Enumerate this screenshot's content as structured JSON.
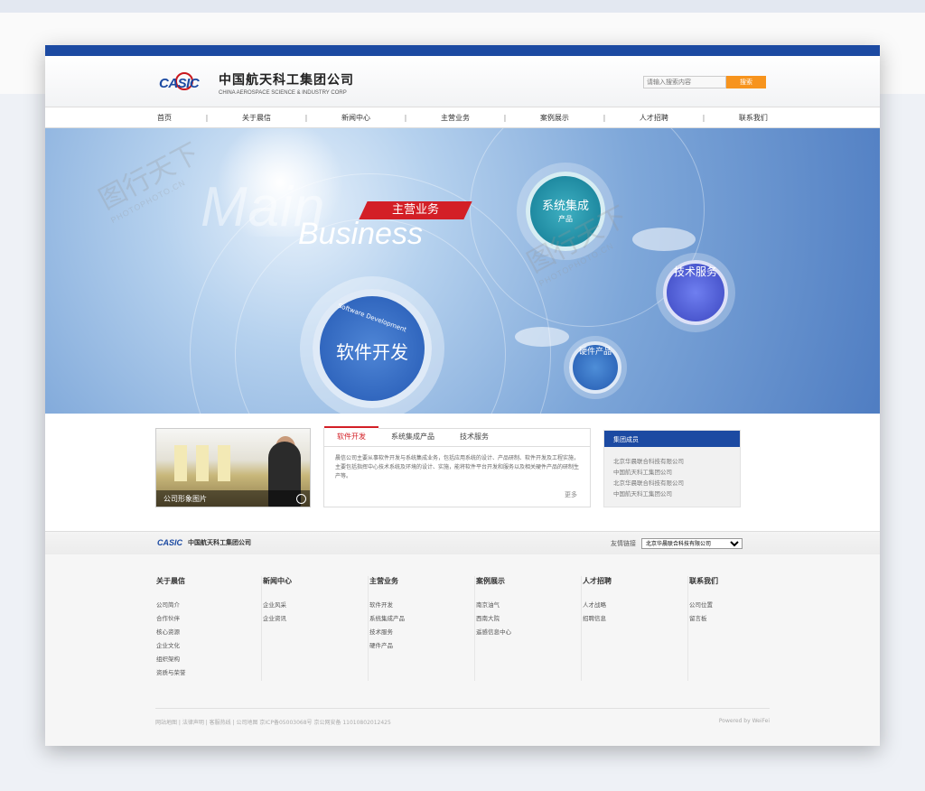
{
  "header": {
    "logo_mark": "CASIC",
    "company_cn": "中国航天科工集团公司",
    "company_en": "CHINA AEROSPACE SCIENCE & INDUSTRY CORP",
    "search_placeholder": "请输入搜索内容",
    "search_button": "搜索"
  },
  "nav": [
    "首页",
    "关于晨信",
    "新闻中心",
    "主营业务",
    "案例展示",
    "人才招聘",
    "联系我们"
  ],
  "banner": {
    "main": "Main",
    "business": "Business",
    "ribbon": "主营业务",
    "big_circle_sub": "Software Development",
    "big_circle_title": "软件开发",
    "system_title": "系统集成",
    "system_sub": "产品",
    "tech": "技术服务",
    "hardware": "硬件产品"
  },
  "content": {
    "photo_caption": "公司形象图片",
    "tabs": [
      "软件开发",
      "系统集成产品",
      "技术服务"
    ],
    "active_tab": 0,
    "tab_text": "晨信公司主要从事软件开发与系统集成业务，包括应用系统的设计、产品研制、软件开发及工程实施，主要包括指挥中心技术系统及环境的设计、实施，能将软件平台开发和服务以及相关硬件产品的研制生产等。",
    "more": "更多",
    "group_title": "集团成员",
    "group_items": [
      "北京华晨联合科技有限公司",
      "中国航天科工集团公司",
      "北京华晨联合科技有限公司",
      "中国航天科工集团公司"
    ]
  },
  "footer": {
    "logo_mark": "CASIC",
    "company_cn": "中国航天科工集团公司",
    "links_label": "友情链接",
    "links_selected": "北京华晨联合科技有限公司",
    "columns": [
      {
        "title": "关于晨信",
        "items": [
          "公司简介",
          "合作伙伴",
          "核心资源",
          "企业文化",
          "组织架构",
          "资质与荣誉"
        ]
      },
      {
        "title": "新闻中心",
        "items": [
          "企业风采",
          "企业资讯"
        ]
      },
      {
        "title": "主营业务",
        "items": [
          "软件开发",
          "系统集成产品",
          "技术服务",
          "硬件产品"
        ]
      },
      {
        "title": "案例展示",
        "items": [
          "南京油气",
          "西南大院",
          "遥感信息中心"
        ]
      },
      {
        "title": "人才招聘",
        "items": [
          "人才战略",
          "招聘信息"
        ]
      },
      {
        "title": "联系我们",
        "items": [
          "公司位置",
          "留言板"
        ]
      }
    ],
    "copyright": "网站地图 | 法律声明 | 客服热线 | 公司地图   京ICP备05003068号 京公网安备 11010802012425",
    "powered": "Powered by WeiFei"
  },
  "watermark": {
    "cn": "图行天下",
    "en": "PHOTOPHOTO.CN"
  },
  "colors": {
    "brand_blue": "#1c4aa2",
    "accent_red": "#d31f26",
    "search_orange": "#f7941d"
  }
}
